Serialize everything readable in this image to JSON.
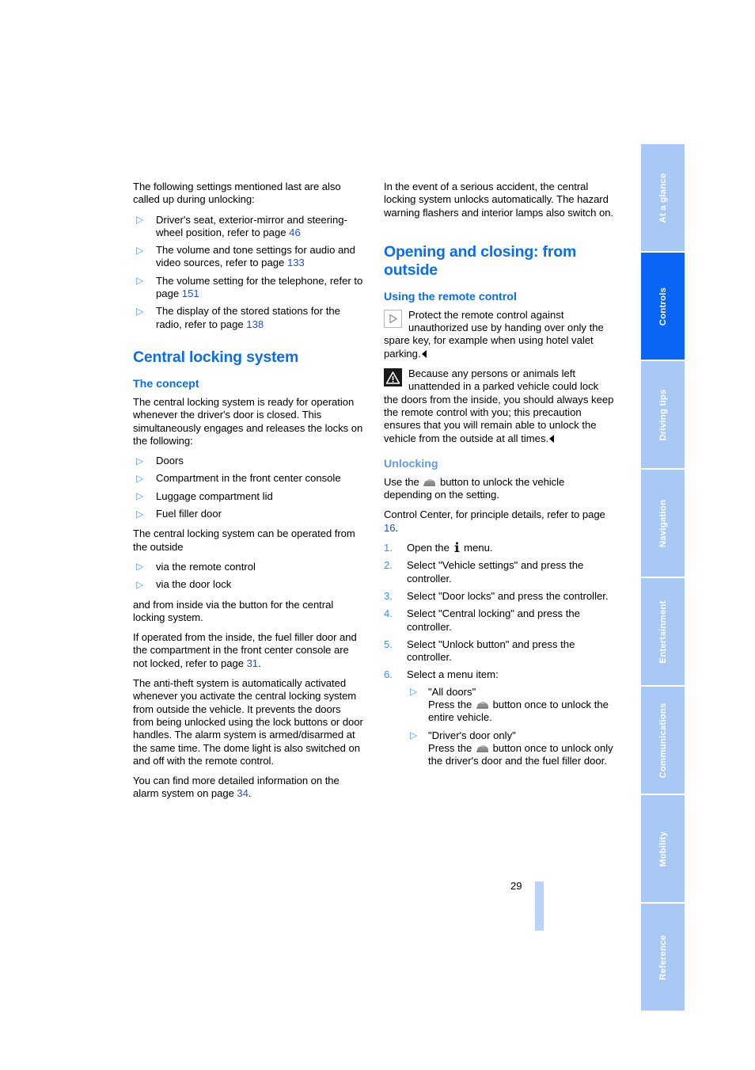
{
  "document": {
    "page_number": "29",
    "accent_blue": "#0b6cf0",
    "light_blue": "#5c9bee",
    "link_blue": "#1a4ef0",
    "tab_blue": "#a8c8f5",
    "tab_active_blue": "#0a64f5"
  },
  "sidebar": {
    "items": [
      {
        "label": "At a glance",
        "active": false
      },
      {
        "label": "Controls",
        "active": true
      },
      {
        "label": "Driving tips",
        "active": false
      },
      {
        "label": "Navigation",
        "active": false
      },
      {
        "label": "Entertainment",
        "active": false
      },
      {
        "label": "Communications",
        "active": false
      },
      {
        "label": "Mobility",
        "active": false
      },
      {
        "label": "Reference",
        "active": false
      }
    ]
  },
  "left_column": {
    "intro": "The following settings mentioned last are also called up during unlocking:",
    "intro_bullets": [
      {
        "text": "Driver's seat, exterior-mirror and steering-wheel position, refer to page ",
        "page_ref": "46",
        "tail": ""
      },
      {
        "text": "The volume and tone settings for audio and video sources, refer to page ",
        "page_ref": "133",
        "tail": ""
      },
      {
        "text": "The volume setting for the telephone, refer to page ",
        "page_ref": "151",
        "tail": ""
      },
      {
        "text": "The display of the stored stations for the radio, refer to page ",
        "page_ref": "138",
        "tail": ""
      }
    ],
    "heading": "Central locking system",
    "subheading": "The concept",
    "concept_para": "The central locking system is ready for operation whenever the driver's door is closed. This simultaneously engages and releases the locks on the following:",
    "concept_bullets": [
      "Doors",
      "Compartment in the front center console",
      "Luggage compartment lid",
      "Fuel filler door"
    ],
    "operated_para": "The central locking system can be operated from the outside",
    "operated_bullets": [
      "via the remote control",
      "via the door lock"
    ],
    "inside_para": "and from inside via the button for the central locking system.",
    "fuel_para_pre": "If operated from the inside, the fuel filler door and the compartment in the front center console are not locked, refer to page ",
    "fuel_para_ref": "31",
    "fuel_para_post": ".",
    "antitheft_para": "The anti-theft system is automatically activated whenever you activate the central locking system from outside the vehicle. It prevents the doors from being unlocked using the lock buttons or door handles. The alarm system is armed/disarmed at the same time. The dome light is also switched on and off with the remote control.",
    "alarm_para_pre": "You can find more detailed information on the alarm system on page ",
    "alarm_para_ref": "34",
    "alarm_para_post": "."
  },
  "right_column": {
    "accident_para": "In the event of a serious accident, the central locking system unlocks automatically. The hazard warning flashers and interior lamps also switch on.",
    "heading": "Opening and closing: from outside",
    "subheading_remote": "Using the remote control",
    "note_text": "Protect the remote control against unauthorized use by handing over only the spare key, for example when using hotel valet parking.",
    "warning_text": "Because any persons or animals left unattended in a parked vehicle could lock the doors from the inside, you should always keep the remote control with you; this precaution ensures that you will remain able to unlock the vehicle from the outside at all times.",
    "subheading_unlocking": "Unlocking",
    "use_button_pre": "Use the ",
    "use_button_post": " button to unlock the vehicle depending on the setting.",
    "control_center_pre": "Control Center, for principle details, refer to page ",
    "control_center_ref": "16",
    "control_center_post": ".",
    "steps": [
      {
        "num": "1.",
        "pre": "Open the ",
        "post": " menu.",
        "has_i_icon": true
      },
      {
        "num": "2.",
        "text": "Select \"Vehicle settings\" and press the controller."
      },
      {
        "num": "3.",
        "text": "Select \"Door locks\" and press the controller."
      },
      {
        "num": "4.",
        "text": "Select \"Central locking\" and press the controller."
      },
      {
        "num": "5.",
        "text": "Select \"Unlock button\" and press the controller."
      },
      {
        "num": "6.",
        "text": "Select a menu item:"
      }
    ],
    "menu_items": [
      {
        "title": "\"All doors\"",
        "body_pre": "Press the ",
        "body_post": " button once to unlock the entire vehicle."
      },
      {
        "title": "\"Driver's door only\"",
        "body_pre": "Press the ",
        "body_post": " button once to unlock only the driver's door and the fuel filler door."
      }
    ]
  },
  "icons": {
    "note": "note-triangle-icon",
    "warning": "warning-triangle-icon",
    "car": "car-unlock-button-icon",
    "info": "info-menu-icon",
    "bullet": "triangle-bullet-icon",
    "end_marker": "end-of-note-marker"
  }
}
